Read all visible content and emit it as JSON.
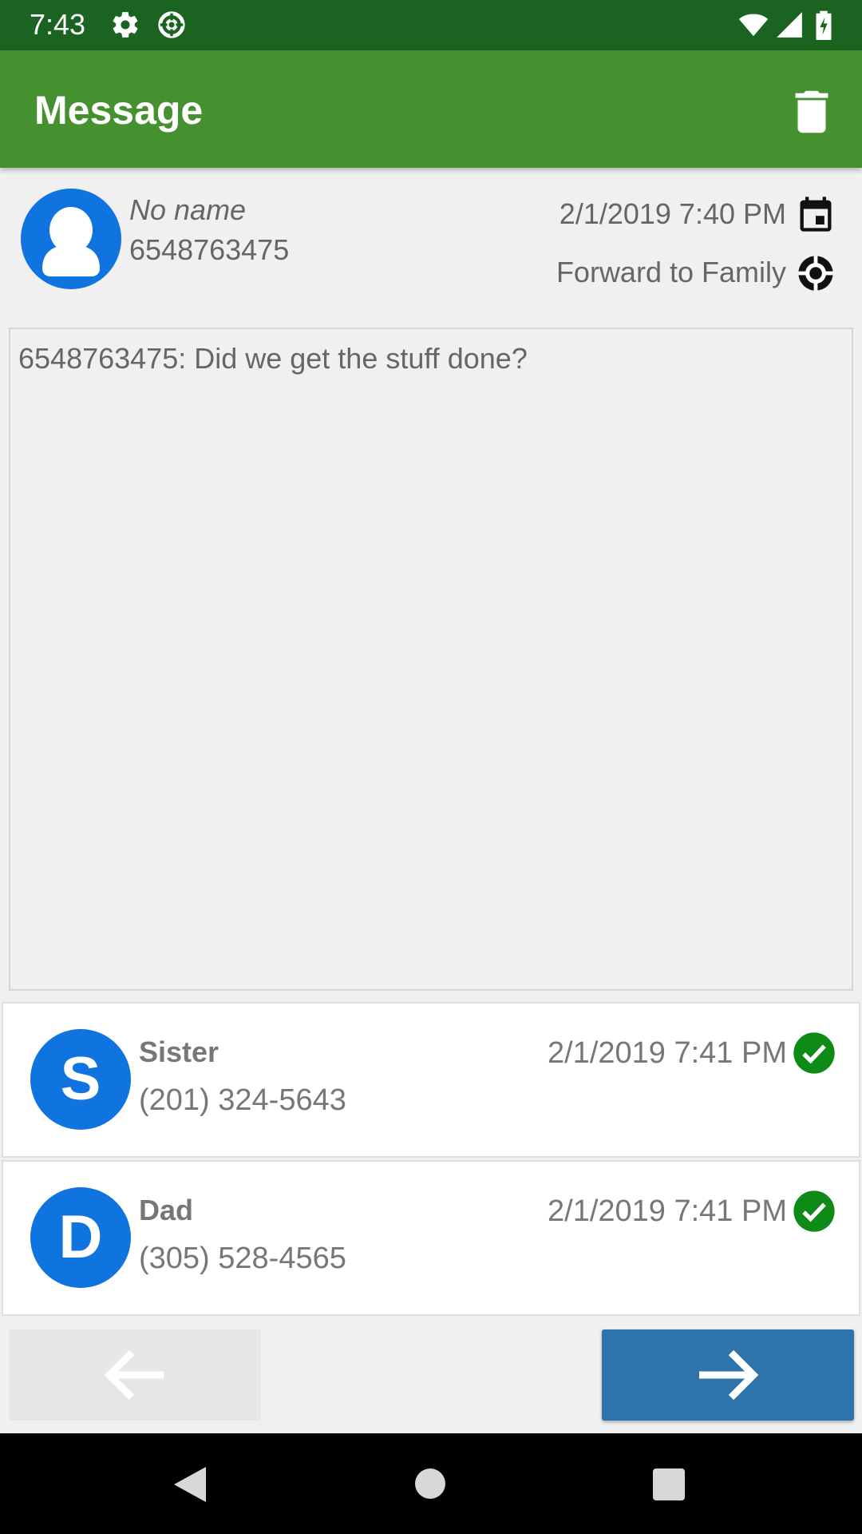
{
  "status_bar": {
    "time": "7:43",
    "icons": [
      "settings-icon",
      "lifebuoy-icon",
      "wifi-icon",
      "signal-icon",
      "battery-charging-icon"
    ]
  },
  "app_bar": {
    "title": "Message",
    "action_icon": "trash-icon"
  },
  "message": {
    "sender_name": "No name",
    "sender_number": "6548763475",
    "date": "2/1/2019 7:40 PM",
    "forward_label": "Forward to Family",
    "body": "6548763475: Did we get the stuff done?"
  },
  "recipients": [
    {
      "initial": "S",
      "name": "Sister",
      "phone": "(201) 324-5643",
      "date": "2/1/2019 7:41 PM",
      "status_icon": "check-circle-icon"
    },
    {
      "initial": "D",
      "name": "Dad",
      "phone": "(305) 528-4565",
      "date": "2/1/2019 7:41 PM",
      "status_icon": "check-circle-icon"
    }
  ],
  "navigation": {
    "prev_icon": "arrow-left-icon",
    "next_icon": "arrow-right-icon"
  },
  "colors": {
    "status_bar": "#1b6320",
    "app_bar": "#46912f",
    "avatar": "#0f73e0",
    "check": "#0e8a17",
    "next_button": "#2f73ab"
  }
}
